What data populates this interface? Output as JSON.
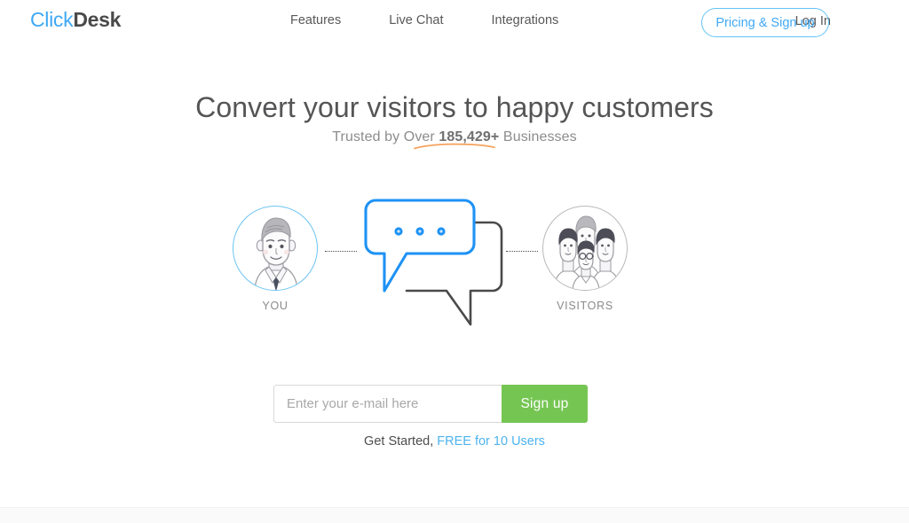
{
  "header": {
    "logo": {
      "part1": "Click",
      "part2": "Desk"
    },
    "nav": [
      {
        "label": "Features",
        "name": "nav-features"
      },
      {
        "label": "Live Chat",
        "name": "nav-live-chat"
      },
      {
        "label": "Integrations",
        "name": "nav-integrations"
      }
    ],
    "login_label": "Log In",
    "pricing_label": "Pricing & Sign up"
  },
  "hero": {
    "title": "Convert your visitors to happy customers",
    "sub_prefix": "Trusted by Over ",
    "sub_count": "185,429+",
    "sub_suffix": " Businesses"
  },
  "illustration": {
    "you_label": "YOU",
    "visitors_label": "VISITORS",
    "you_icon": "person-avatar-icon",
    "visitors_icon": "people-group-avatar-icon",
    "bubble_icon": "chat-bubbles-icon",
    "typing_dots": 3
  },
  "signup": {
    "email_placeholder": "Enter your e-mail here",
    "email_value": "",
    "button_label": "Sign up",
    "note_prefix": "Get Started, ",
    "note_link": "FREE for 10 Users"
  },
  "colors": {
    "brand_blue": "#3fa9f5",
    "bubble_blue": "#2196f3",
    "signup_green": "#75c553",
    "accent_orange": "#f5a25d",
    "text_gray": "#585858",
    "link_blue": "#4db3ef"
  }
}
